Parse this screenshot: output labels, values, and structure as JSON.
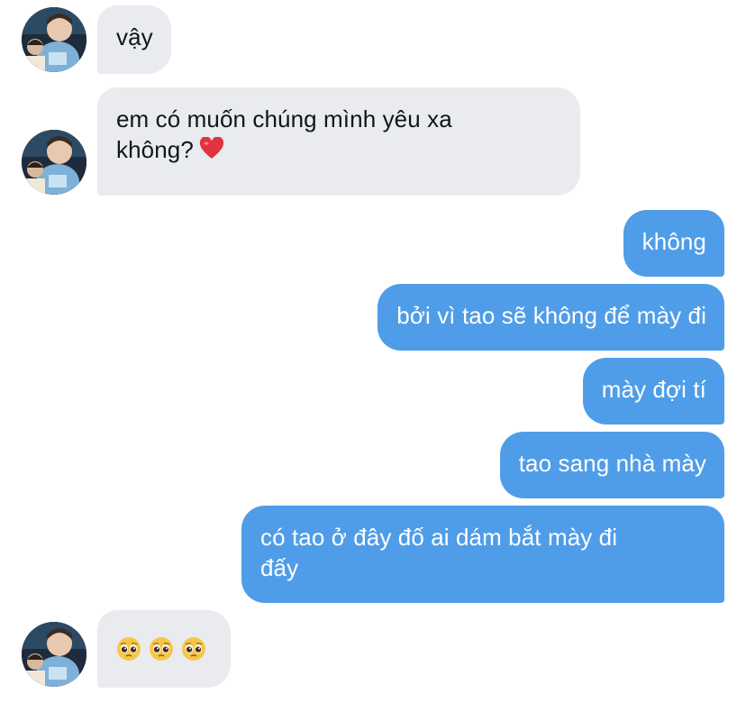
{
  "messages": [
    {
      "id": "m1",
      "side": "incoming",
      "text": "vậy"
    },
    {
      "id": "m2",
      "side": "incoming",
      "line1": "em có muốn chúng mình yêu xa",
      "line2": "không?",
      "emoji": "red-heart"
    },
    {
      "id": "m3",
      "side": "outgoing",
      "text": "không"
    },
    {
      "id": "m4",
      "side": "outgoing",
      "text": "bởi vì tao sẽ không để mày đi"
    },
    {
      "id": "m5",
      "side": "outgoing",
      "text": "mày đợi tí"
    },
    {
      "id": "m6",
      "side": "outgoing",
      "text": "tao sang nhà mày"
    },
    {
      "id": "m7",
      "side": "outgoing",
      "line1": "có tao ở đây đố ai dám bắt mày đi",
      "line2": "đấy"
    },
    {
      "id": "m8",
      "side": "incoming",
      "emojis": [
        "pleading-face",
        "pleading-face",
        "pleading-face"
      ]
    }
  ],
  "colors": {
    "incoming_bubble": "#e9ebef",
    "outgoing_bubble": "#4f9de8",
    "incoming_text": "#10161b",
    "outgoing_text": "#ffffff",
    "heart": "#e0323f"
  }
}
